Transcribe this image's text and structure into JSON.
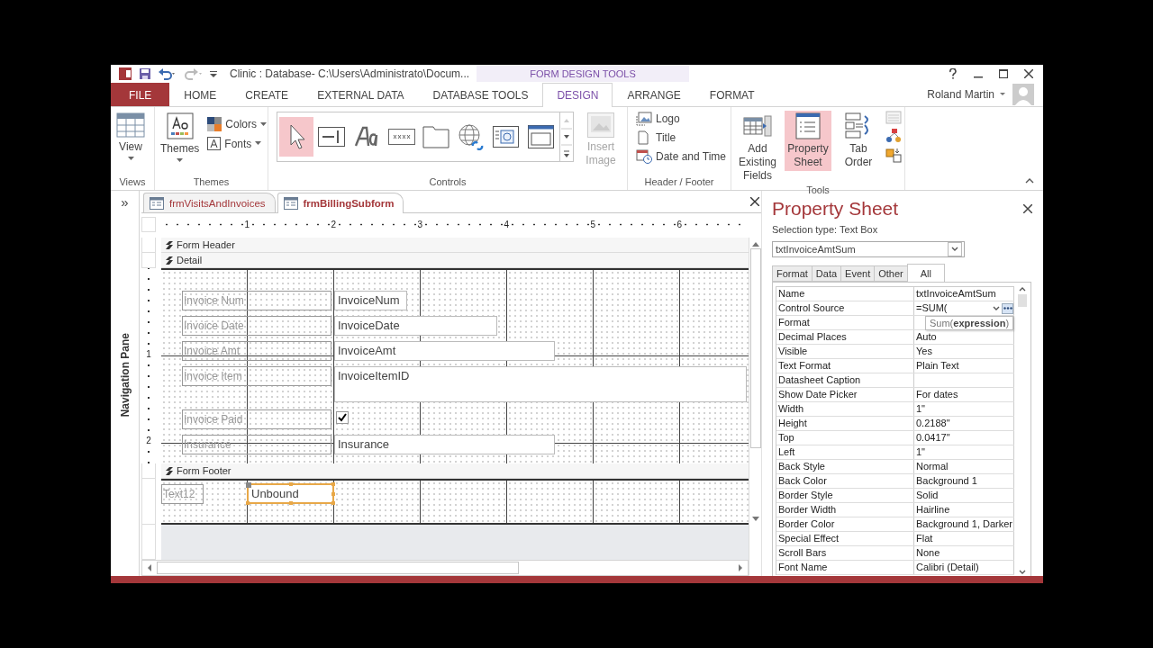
{
  "window": {
    "title": "Clinic : Database- C:\\Users\\Administrato\\Docum...",
    "context_title": "FORM DESIGN TOOLS"
  },
  "ribbon_tabs": [
    {
      "label": "FILE",
      "kind": "file",
      "selected": false
    },
    {
      "label": "HOME",
      "kind": "tab",
      "selected": false
    },
    {
      "label": "CREATE",
      "kind": "tab",
      "selected": false
    },
    {
      "label": "EXTERNAL DATA",
      "kind": "tab",
      "selected": false
    },
    {
      "label": "DATABASE TOOLS",
      "kind": "tab",
      "selected": false
    },
    {
      "label": "DESIGN",
      "kind": "context",
      "selected": true
    },
    {
      "label": "ARRANGE",
      "kind": "context",
      "selected": false
    },
    {
      "label": "FORMAT",
      "kind": "context",
      "selected": false
    }
  ],
  "user": {
    "name": "Roland Martin"
  },
  "ribbon": {
    "views": {
      "label": "Views",
      "button": "View"
    },
    "themes": {
      "label": "Themes",
      "button": "Themes",
      "colors": "Colors",
      "fonts": "Fonts"
    },
    "controls": {
      "label": "Controls",
      "tools": [
        {
          "selected": true
        },
        {
          "selected": false
        },
        {
          "selected": false
        },
        {
          "selected": false
        },
        {
          "selected": false
        },
        {
          "selected": false
        },
        {
          "selected": false
        },
        {
          "selected": false
        }
      ],
      "insert_image": "Insert Image",
      "insert_image_disabled": true
    },
    "header_footer": {
      "label": "Header / Footer",
      "items": [
        "Logo",
        "Title",
        "Date and Time"
      ]
    },
    "tools": {
      "label": "Tools",
      "items": [
        {
          "label": "Add Existing Fields",
          "selected": false
        },
        {
          "label": "Property Sheet",
          "selected": true
        },
        {
          "label": "Tab Order",
          "selected": false
        }
      ]
    }
  },
  "nav_pane": {
    "label": "Navigation Pane",
    "expand": "»"
  },
  "document_tabs": [
    {
      "label": "frmVisitsAndInvoices",
      "selected": false
    },
    {
      "label": "frmBillingSubform",
      "selected": true
    }
  ],
  "ruler": {
    "marks": [
      "1",
      "2",
      "3",
      "4",
      "5",
      "6"
    ],
    "vertical_marks": [
      "1",
      "2"
    ]
  },
  "form": {
    "header_label": "Form Header",
    "detail_label": "Detail",
    "footer_label": "Form Footer",
    "detail_rows": [
      {
        "label": "Invoice Num",
        "kind": "textbox",
        "field": "InvoiceNum"
      },
      {
        "label": "Invoice Date",
        "kind": "textbox",
        "field": "InvoiceDate"
      },
      {
        "label": "Invoice Amt",
        "kind": "textbox",
        "field": "InvoiceAmt"
      },
      {
        "label": "Invoice Item",
        "kind": "textbox",
        "field": "InvoiceItemID"
      },
      {
        "label": "Invoice Paid",
        "kind": "checkbox",
        "checked": true
      },
      {
        "label": "Insurance",
        "kind": "textbox",
        "field": "Insurance"
      }
    ],
    "footer": {
      "label": "Text12",
      "field": "Unbound",
      "selected": true
    }
  },
  "property_sheet": {
    "title": "Property Sheet",
    "selection_type": "Selection type:  Text Box",
    "object": "txtInvoiceAmtSum",
    "tabs": [
      {
        "label": "Format",
        "selected": false
      },
      {
        "label": "Data",
        "selected": false
      },
      {
        "label": "Event",
        "selected": false
      },
      {
        "label": "Other",
        "selected": false
      },
      {
        "label": "All",
        "selected": true
      }
    ],
    "rows": [
      {
        "name": "Name",
        "value": "txtInvoiceAmtSum",
        "editing": false
      },
      {
        "name": "Control Source",
        "value": "=SUM(",
        "editing": true
      },
      {
        "name": "Format",
        "value": "",
        "editing": false
      },
      {
        "name": "Decimal Places",
        "value": "Auto",
        "editing": false
      },
      {
        "name": "Visible",
        "value": "Yes",
        "editing": false
      },
      {
        "name": "Text Format",
        "value": "Plain Text",
        "editing": false
      },
      {
        "name": "Datasheet Caption",
        "value": "",
        "editing": false
      },
      {
        "name": "Show Date Picker",
        "value": "For dates",
        "editing": false
      },
      {
        "name": "Width",
        "value": "1\"",
        "editing": false
      },
      {
        "name": "Height",
        "value": "0.2188\"",
        "editing": false
      },
      {
        "name": "Top",
        "value": "0.0417\"",
        "editing": false
      },
      {
        "name": "Left",
        "value": "1\"",
        "editing": false
      },
      {
        "name": "Back Style",
        "value": "Normal",
        "editing": false
      },
      {
        "name": "Back Color",
        "value": "Background 1",
        "editing": false
      },
      {
        "name": "Border Style",
        "value": "Solid",
        "editing": false
      },
      {
        "name": "Border Width",
        "value": "Hairline",
        "editing": false
      },
      {
        "name": "Border Color",
        "value": "Background 1, Darker",
        "editing": false
      },
      {
        "name": "Special Effect",
        "value": "Flat",
        "editing": false
      },
      {
        "name": "Scroll Bars",
        "value": "None",
        "editing": false
      },
      {
        "name": "Font Name",
        "value": "Calibri (Detail)",
        "editing": false
      }
    ],
    "tooltip": "Sum(**expression**)"
  }
}
